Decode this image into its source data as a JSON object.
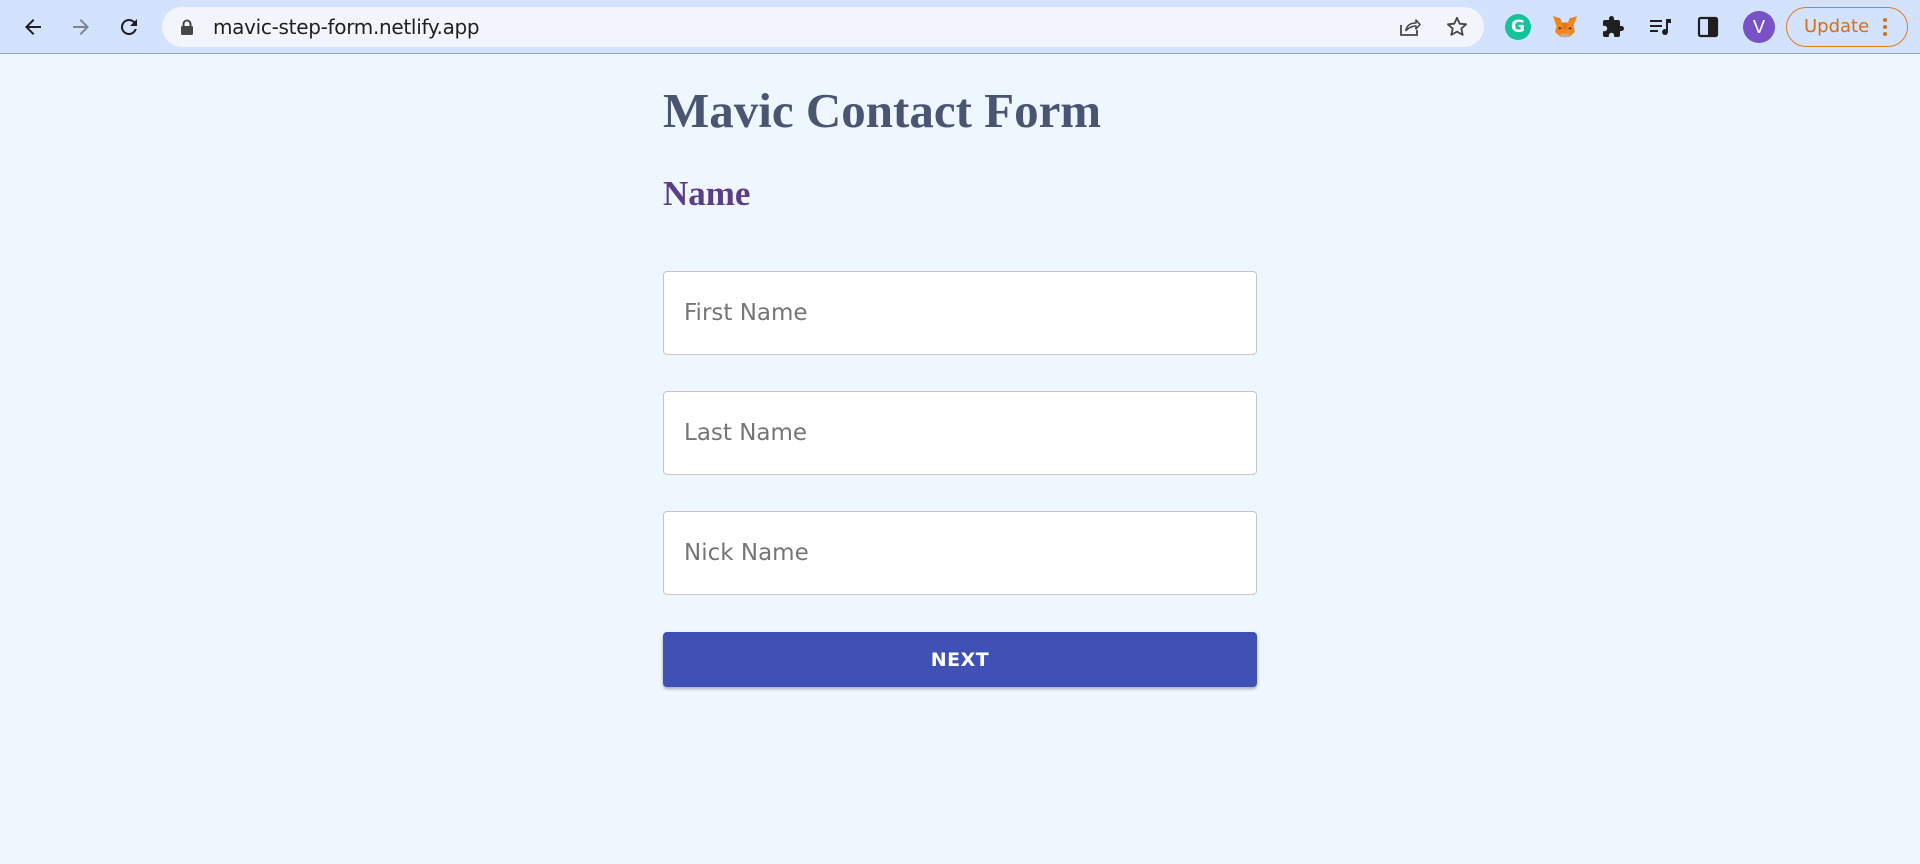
{
  "browser": {
    "url": "mavic-step-form.netlify.app",
    "avatar_letter": "V",
    "update_label": "Update",
    "grammarly_letter": "G",
    "icons": [
      "back-arrow-icon",
      "forward-arrow-icon",
      "reload-icon",
      "lock-icon",
      "share-icon",
      "star-icon",
      "grammarly-icon",
      "metamask-fox-icon",
      "puzzle-extensions-icon",
      "reading-list-icon",
      "side-panel-icon",
      "menu-dots-icon"
    ]
  },
  "form": {
    "title": "Mavic Contact Form",
    "step_title": "Name",
    "fields": {
      "first_name": {
        "placeholder": "First Name",
        "value": ""
      },
      "last_name": {
        "placeholder": "Last Name",
        "value": ""
      },
      "nick_name": {
        "placeholder": "Nick Name",
        "value": ""
      }
    },
    "next_label": "NEXT"
  },
  "colors": {
    "page_background": "#eef6fe",
    "title": "#4a5572",
    "step_title": "#5b3f86",
    "button": "#3f51b5",
    "update_accent": "#d56e14"
  }
}
